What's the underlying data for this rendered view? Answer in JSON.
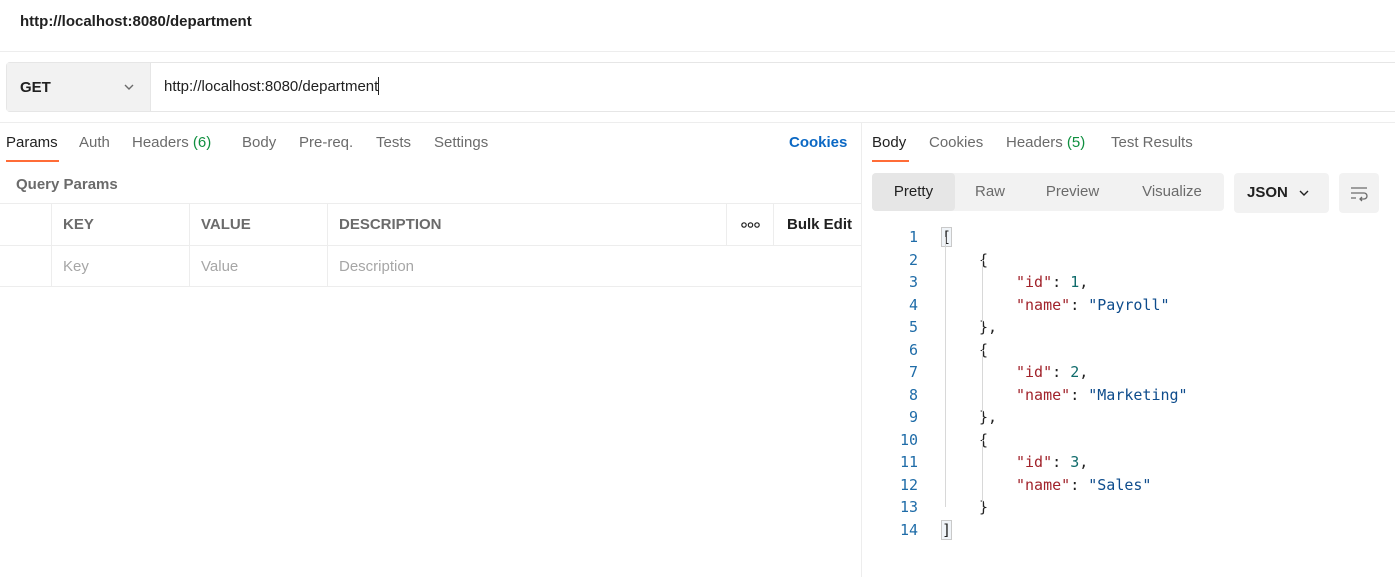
{
  "request": {
    "title": "http://localhost:8080/department",
    "method": "GET",
    "url": "http://localhost:8080/department"
  },
  "request_tabs": [
    {
      "label": "Params",
      "count": ""
    },
    {
      "label": "Auth",
      "count": ""
    },
    {
      "label": "Headers",
      "count": "(6)"
    },
    {
      "label": "Body",
      "count": ""
    },
    {
      "label": "Pre-req.",
      "count": ""
    },
    {
      "label": "Tests",
      "count": ""
    },
    {
      "label": "Settings",
      "count": ""
    }
  ],
  "cookies_link": "Cookies",
  "query_params": {
    "label": "Query Params",
    "headers": {
      "key": "KEY",
      "value": "VALUE",
      "description": "DESCRIPTION",
      "more": "ooo",
      "bulk_edit": "Bulk Edit"
    },
    "placeholders": {
      "key": "Key",
      "value": "Value",
      "description": "Description"
    }
  },
  "response_tabs": [
    {
      "label": "Body",
      "count": ""
    },
    {
      "label": "Cookies",
      "count": ""
    },
    {
      "label": "Headers",
      "count": "(5)"
    },
    {
      "label": "Test Results",
      "count": ""
    }
  ],
  "view_modes": [
    "Pretty",
    "Raw",
    "Preview",
    "Visualize"
  ],
  "format": "JSON",
  "icons": {
    "method_dropdown": "chevron-down-icon",
    "format_dropdown": "chevron-down-icon",
    "wrap": "wrap-lines-icon",
    "more": "more-options-icon"
  },
  "colors": {
    "accent": "#ff6c37",
    "link": "#0b68c4",
    "count": "#0f8f3f"
  },
  "response_body": [
    {
      "n": "1",
      "text": "["
    },
    {
      "n": "2",
      "text": "{"
    },
    {
      "n": "3",
      "key": "\"id\"",
      "val": "1",
      "type": "num",
      "trail": ","
    },
    {
      "n": "4",
      "key": "\"name\"",
      "val": "\"Payroll\"",
      "type": "str",
      "trail": ""
    },
    {
      "n": "5",
      "text": "},"
    },
    {
      "n": "6",
      "text": "{"
    },
    {
      "n": "7",
      "key": "\"id\"",
      "val": "2",
      "type": "num",
      "trail": ","
    },
    {
      "n": "8",
      "key": "\"name\"",
      "val": "\"Marketing\"",
      "type": "str",
      "trail": ""
    },
    {
      "n": "9",
      "text": "},"
    },
    {
      "n": "10",
      "text": "{"
    },
    {
      "n": "11",
      "key": "\"id\"",
      "val": "3",
      "type": "num",
      "trail": ","
    },
    {
      "n": "12",
      "key": "\"name\"",
      "val": "\"Sales\"",
      "type": "str",
      "trail": ""
    },
    {
      "n": "13",
      "text": "}"
    },
    {
      "n": "14",
      "text": "]"
    }
  ]
}
